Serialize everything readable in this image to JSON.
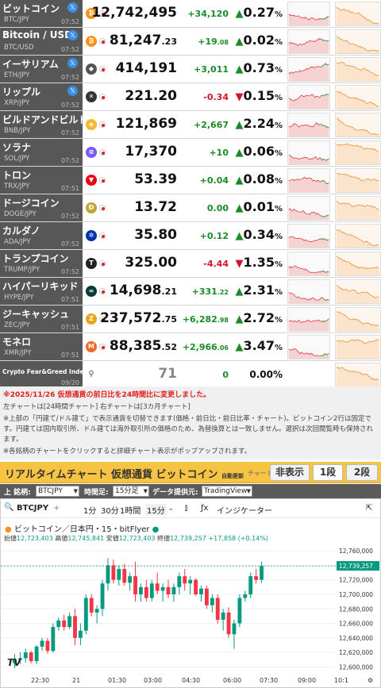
{
  "rows": [
    {
      "name": "ビットコイン",
      "pair": "BTC/JPY",
      "time": "07:52",
      "x": true,
      "icon": "₿",
      "icon_color": "#f7931a",
      "price_main": "12,742,495",
      "price_dec": "",
      "change_main": "+34,120",
      "change_dec": "",
      "dir": "up",
      "pct": "0.27",
      "flag": "jp"
    },
    {
      "name": "Bitcoin / USD",
      "pair": "BTC/USD",
      "time": "07:52",
      "x": true,
      "icon": "₿",
      "icon_color": "#f7931a",
      "price_main": "81,247",
      "price_dec": ".23",
      "change_main": "+19",
      "change_dec": ".08",
      "dir": "up",
      "pct": "0.02",
      "flag": "us"
    },
    {
      "name": "イーサリアム",
      "pair": "ETH/JPY",
      "time": "07:52",
      "x": true,
      "icon": "◆",
      "icon_color": "#555",
      "price_main": "414,191",
      "price_dec": "",
      "change_main": "+3,011",
      "change_dec": "",
      "dir": "up",
      "pct": "0.73",
      "flag": "jp"
    },
    {
      "name": "リップル",
      "pair": "XRP/JPY",
      "time": "07:52",
      "x": true,
      "icon": "✕",
      "icon_color": "#333",
      "price_main": "221.20",
      "price_dec": "",
      "change_main": "-0.34",
      "change_dec": "",
      "dir": "dn",
      "pct": "0.15",
      "flag": "jp"
    },
    {
      "name": "ビルドアンドビルド",
      "pair": "BNB/JPY",
      "time": "07:52",
      "x": false,
      "icon": "◈",
      "icon_color": "#f3ba2f",
      "price_main": "121,869",
      "price_dec": "",
      "change_main": "+2,667",
      "change_dec": "",
      "dir": "up",
      "pct": "2.24",
      "flag": "jp"
    },
    {
      "name": "ソラナ",
      "pair": "SOL/JPY",
      "time": "07:52",
      "x": false,
      "icon": "≡",
      "icon_color": "#7a5af8",
      "price_main": "17,370",
      "price_dec": "",
      "change_main": "+10",
      "change_dec": "",
      "dir": "up",
      "pct": "0.06",
      "flag": "jp"
    },
    {
      "name": "トロン",
      "pair": "TRX/JPY",
      "time": "07:51",
      "x": false,
      "icon": "▼",
      "icon_color": "#e50914",
      "price_main": "53.39",
      "price_dec": "",
      "change_main": "+0.04",
      "change_dec": "",
      "dir": "up",
      "pct": "0.08",
      "flag": "jp"
    },
    {
      "name": "ドージコイン",
      "pair": "DOGE/JPY",
      "time": "07:52",
      "x": false,
      "icon": "Ð",
      "icon_color": "#c2a633",
      "price_main": "13.72",
      "price_dec": "",
      "change_main": "0.00",
      "change_dec": "",
      "dir": "up",
      "pct": "0.01",
      "flag": "jp"
    },
    {
      "name": "カルダノ",
      "pair": "ADA/JPY",
      "time": "07:52",
      "x": false,
      "icon": "✲",
      "icon_color": "#0033ad",
      "price_main": "35.80",
      "price_dec": "",
      "change_main": "+0.12",
      "change_dec": "",
      "dir": "up",
      "pct": "0.34",
      "flag": "jp"
    },
    {
      "name": "トランプコイン",
      "pair": "TRUMP/JPY",
      "time": "07:52",
      "x": false,
      "icon": "T",
      "icon_color": "#222",
      "price_main": "325.00",
      "price_dec": "",
      "change_main": "-4.44",
      "change_dec": "",
      "dir": "dn",
      "pct": "1.35",
      "flag": "jp"
    },
    {
      "name": "ハイパーリキッド",
      "pair": "HYPE/JPY",
      "time": "07:51",
      "x": false,
      "icon": "∞",
      "icon_color": "#0b3a35",
      "price_main": "14,698",
      "price_dec": ".21",
      "change_main": "+331",
      "change_dec": ".22",
      "dir": "up",
      "pct": "2.31",
      "flag": "jp"
    },
    {
      "name": "ジーキャッシュ",
      "pair": "ZEC/JPY",
      "time": "07:51",
      "x": false,
      "icon": "Z",
      "icon_color": "#e8a317",
      "price_main": "237,572",
      "price_dec": ".75",
      "change_main": "+6,282",
      "change_dec": ".98",
      "dir": "up",
      "pct": "2.72",
      "flag": "jp"
    },
    {
      "name": "モネロ",
      "pair": "XMR/JPY",
      "time": "07:51",
      "x": false,
      "icon": "M",
      "icon_color": "#f26822",
      "price_main": "88,385",
      "price_dec": ".52",
      "change_main": "+2,966",
      "change_dec": ".06",
      "dir": "up",
      "pct": "3.47",
      "flag": "jp"
    },
    {
      "name": "Crypto Fear&Greed Index",
      "pair": "",
      "time": "09/20",
      "x": false,
      "icon": "",
      "icon_color": "#888",
      "price_main": "71",
      "price_dec": "",
      "change_main": "0",
      "change_dec": "",
      "dir": "none",
      "pct": "0.00",
      "flag": "none",
      "fg": true
    }
  ],
  "notes": {
    "note1": "※2025/11/26 仮想通貨の前日比を24時間比に変更しました。",
    "note2": "左チャートは[24時間チャート] 右チャートは[3カ月チャート]",
    "note3": "※上部の「円建て/ドル建て」で表示通貨を切替できます(価格・前日比・前日比率・チャート)。ビットコイン2行は固定です。円建ては国内取引所、ドル建ては海外取引所の価格のため、為替換算とは一致しません。選択は次回閲覧時も保持されます。",
    "note4": "※各銘柄のチャートをクリックすると詳細チャート表示がポップアップされます。"
  },
  "realtime": {
    "title": "リアルタイムチャート 仮想通貨 ビットコイン",
    "auto": "自動更新",
    "chart_label": "チャート：",
    "btn_hide": "非表示",
    "btn_1": "1段",
    "btn_2": "2段",
    "opt_symbol_label": "上 銘柄:",
    "opt_symbol": "BTCJPY",
    "opt_time_label": "時間足:",
    "opt_time": "15分足",
    "opt_source_label": "データ提供元:",
    "opt_source": "TradingView"
  },
  "tv": {
    "symbol": "BTCJPY",
    "tf1": "1分",
    "tf2": "30分",
    "tf3": "1時間",
    "tf4": "15分",
    "indicator": "インジケーター",
    "series_title": "ビットコイン／日本円・15・bitFlyer",
    "o_label": "始値",
    "o_val": "12,723,403",
    "h_label": "高値",
    "h_val": "12,745,841",
    "l_label": "安値",
    "l_val": "12,723,403",
    "c_label": "終値",
    "c_val": "12,739,257",
    "chg_val": "+17,858 (+0.14%)",
    "current_price": "12,739,257"
  },
  "chart_data": {
    "type": "candlestick",
    "title": "ビットコイン／日本円・15・bitFlyer",
    "y_ticks": [
      12600000,
      12620000,
      12640000,
      12660000,
      12680000,
      12700000,
      12720000,
      12740000,
      12760000
    ],
    "ylim": [
      12595000,
      12770000
    ],
    "x_ticks": [
      "22:30",
      "21",
      "01:30",
      "03:00",
      "04:30",
      "06:00",
      "07:30",
      "09:00",
      "10:1"
    ],
    "candles": [
      [
        12605000,
        12618000,
        12598000,
        12610000
      ],
      [
        12610000,
        12620000,
        12604000,
        12612000
      ],
      [
        12612000,
        12625000,
        12606000,
        12620000
      ],
      [
        12620000,
        12622000,
        12605000,
        12608000
      ],
      [
        12608000,
        12630000,
        12604000,
        12628000
      ],
      [
        12628000,
        12640000,
        12622000,
        12636000
      ],
      [
        12636000,
        12640000,
        12618000,
        12622000
      ],
      [
        12622000,
        12660000,
        12620000,
        12655000
      ],
      [
        12655000,
        12668000,
        12650000,
        12664000
      ],
      [
        12664000,
        12672000,
        12650000,
        12655000
      ],
      [
        12655000,
        12675000,
        12652000,
        12670000
      ],
      [
        12670000,
        12680000,
        12630000,
        12640000
      ],
      [
        12640000,
        12660000,
        12630000,
        12650000
      ],
      [
        12650000,
        12700000,
        12645000,
        12695000
      ],
      [
        12695000,
        12700000,
        12670000,
        12675000
      ],
      [
        12675000,
        12685000,
        12660000,
        12680000
      ],
      [
        12680000,
        12720000,
        12670000,
        12715000
      ],
      [
        12715000,
        12750000,
        12705000,
        12740000
      ],
      [
        12740000,
        12748000,
        12715000,
        12720000
      ],
      [
        12720000,
        12740000,
        12712000,
        12735000
      ],
      [
        12735000,
        12742000,
        12712000,
        12716000
      ],
      [
        12716000,
        12730000,
        12705000,
        12725000
      ],
      [
        12725000,
        12745000,
        12690000,
        12700000
      ],
      [
        12700000,
        12715000,
        12690000,
        12710000
      ],
      [
        12710000,
        12720000,
        12690000,
        12695000
      ],
      [
        12695000,
        12720000,
        12690000,
        12715000
      ],
      [
        12715000,
        12730000,
        12700000,
        12705000
      ],
      [
        12705000,
        12715000,
        12690000,
        12710000
      ],
      [
        12710000,
        12720000,
        12695000,
        12700000
      ],
      [
        12700000,
        12715000,
        12690000,
        12710000
      ],
      [
        12710000,
        12730000,
        12700000,
        12725000
      ],
      [
        12725000,
        12735000,
        12705000,
        12715000
      ],
      [
        12715000,
        12725000,
        12700000,
        12720000
      ],
      [
        12720000,
        12722000,
        12698000,
        12700000
      ],
      [
        12700000,
        12712000,
        12690000,
        12708000
      ],
      [
        12708000,
        12712000,
        12680000,
        12685000
      ],
      [
        12685000,
        12700000,
        12675000,
        12695000
      ],
      [
        12695000,
        12700000,
        12660000,
        12665000
      ],
      [
        12665000,
        12680000,
        12650000,
        12675000
      ],
      [
        12675000,
        12682000,
        12640000,
        12645000
      ],
      [
        12645000,
        12665000,
        12625000,
        12660000
      ],
      [
        12660000,
        12700000,
        12655000,
        12695000
      ],
      [
        12695000,
        12705000,
        12690000,
        12700000
      ],
      [
        12700000,
        12730000,
        12695000,
        12725000
      ],
      [
        12725000,
        12735000,
        12715000,
        12720000
      ],
      [
        12720000,
        12745000,
        12716000,
        12739257
      ]
    ]
  }
}
